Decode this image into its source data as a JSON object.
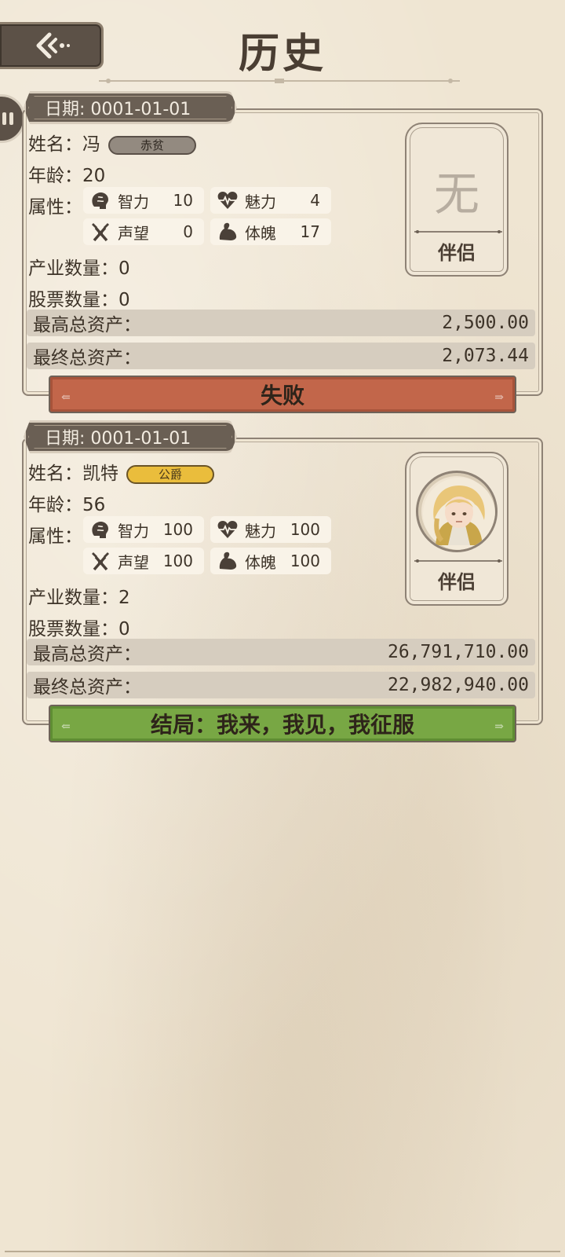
{
  "header": {
    "title": "历史"
  },
  "labels": {
    "date_prefix": "日期: ",
    "name": "姓名：",
    "age": "年龄：",
    "attributes": "属性：",
    "industry_count": "产业数量：",
    "stock_count": "股票数量：",
    "max_assets": "最高总资产：",
    "final_assets": "最终总资产：",
    "partner": "伴侣",
    "stat_intelligence": "智力",
    "stat_charm": "魅力",
    "stat_reputation": "声望",
    "stat_physique": "体魄"
  },
  "records": [
    {
      "date": "日期: 0001-01-01",
      "name": "冯",
      "rank": "赤贫",
      "age": "20",
      "intelligence": "10",
      "charm": "4",
      "reputation": "0",
      "physique": "17",
      "industry_count": "0",
      "stock_count": "0",
      "max_assets": "2,500.00",
      "final_assets": "2,073.44",
      "partner_empty": "无",
      "result": "失败"
    },
    {
      "date": "日期: 0001-01-01",
      "name": "凯特",
      "rank": "公爵",
      "age": "56",
      "intelligence": "100",
      "charm": "100",
      "reputation": "100",
      "physique": "100",
      "industry_count": "2",
      "stock_count": "0",
      "max_assets": "26,791,710.00",
      "final_assets": "22,982,940.00",
      "result": "结局：我来，我见，我征服"
    }
  ],
  "colors": {
    "fail": "#c2664a",
    "win": "#78a744",
    "rank_poor": "#938a80",
    "rank_duke": "#eabd3c"
  }
}
